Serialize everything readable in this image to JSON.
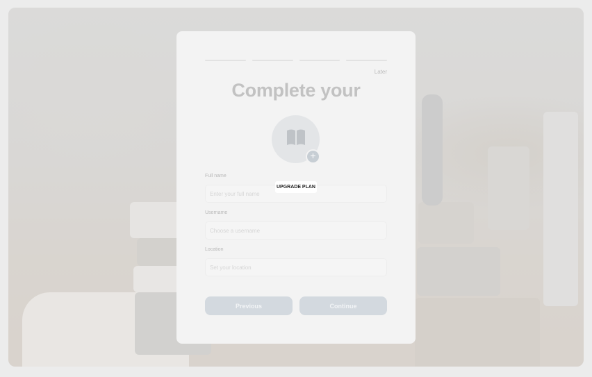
{
  "onboarding": {
    "later_label": "Later",
    "title": "Complete your",
    "avatar_icon": "book-icon",
    "avatar_add_icon": "plus-icon",
    "avatar_add_symbol": "+",
    "upgrade_label": "UPGRADE PLAN",
    "fields": [
      {
        "label": "Full name",
        "placeholder": "Enter your full name",
        "value": ""
      },
      {
        "label": "Username",
        "placeholder": "Choose a username",
        "value": ""
      },
      {
        "label": "Location",
        "placeholder": "Set your location",
        "value": ""
      }
    ],
    "previous_label": "Previous",
    "continue_label": "Continue",
    "progress_steps": 4
  },
  "colors": {
    "card_bg": "#f3f3f3",
    "button_bg": "#d3d9df",
    "title": "#c2c2c2"
  }
}
